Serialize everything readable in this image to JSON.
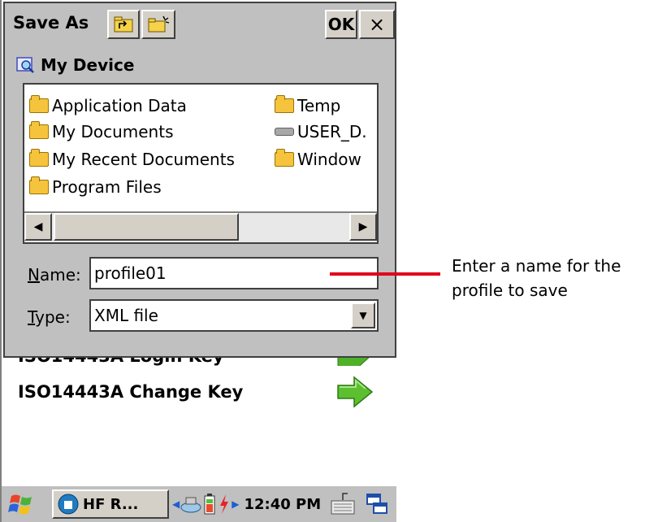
{
  "dialog": {
    "title": "Save As",
    "ok_label": "OK",
    "close_label": "×",
    "location": "My Device",
    "files": [
      {
        "name": "Application Data",
        "kind": "folder"
      },
      {
        "name": "My Documents",
        "kind": "folder"
      },
      {
        "name": "My Recent Documents",
        "kind": "folder"
      },
      {
        "name": "Program Files",
        "kind": "folder"
      },
      {
        "name": "Temp",
        "kind": "folder"
      },
      {
        "name": "USER_D.",
        "kind": "drive"
      },
      {
        "name": "Window",
        "kind": "folder"
      }
    ],
    "name_label": "Name:",
    "name_label_mnemonic": "N",
    "name_label_rest": "ame:",
    "name_value": "profile01",
    "type_label_mnemonic": "T",
    "type_label_rest": "ype:",
    "type_value": "XML file"
  },
  "background": {
    "partial_item": "ISO14443A Login Key",
    "item": "ISO14443A Change Key"
  },
  "taskbar": {
    "app_label": "HF R...",
    "time": "12:40 PM"
  },
  "annotation": {
    "line1": "Enter a name for the",
    "line2": "profile to save",
    "color": "#e0001b"
  }
}
